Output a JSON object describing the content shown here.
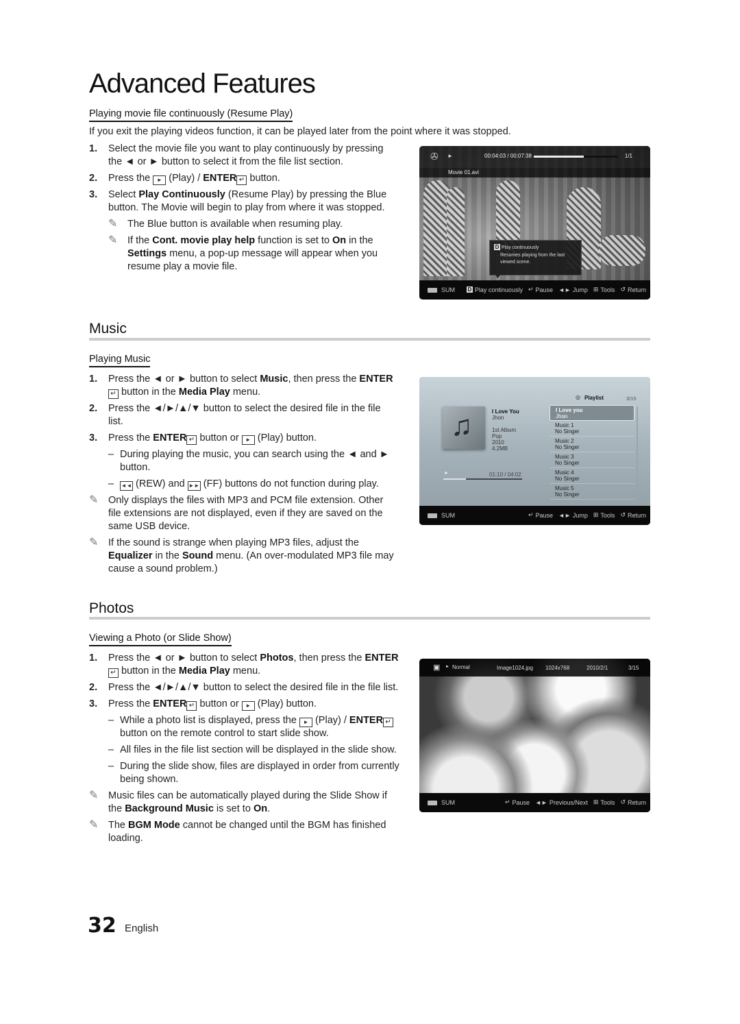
{
  "page": {
    "title": "Advanced Features",
    "page_number": "32",
    "language": "English"
  },
  "resume": {
    "subheading": "Playing movie file continuously (Resume Play)",
    "intro": "If you exit the playing videos function, it can be played later from the point where it was stopped.",
    "steps": [
      {
        "num": "1.",
        "html": "Select the movie file you want to play continuously by pressing the ◄ or ► button to select it from the file list section."
      },
      {
        "num": "2.",
        "html": "Press the <span class='btn-box'>►</span> (Play) / <b>ENTER</b><span class='enter-glyph'>↵</span> button."
      },
      {
        "num": "3.",
        "html": "Select <b>Play Continuously</b> (Resume Play) by pressing the Blue button. The Movie will begin to play from where it was stopped."
      }
    ],
    "notes": [
      {
        "html": "The Blue button is available when resuming play."
      },
      {
        "html": "If the <b>Cont. movie play help</b> function is set to <b>On</b> in the <b>Settings</b> menu, a pop-up message will appear when you resume play a movie file."
      }
    ],
    "screen": {
      "time": "00:04:03 / 00:07:38",
      "progress": 0.59,
      "count": "1/1",
      "filename": "Movie 01.avi",
      "popup_key": "D",
      "popup_title": "Play continuously",
      "popup_text": "Resumes playing from the last viewed scene.",
      "device": "SUM",
      "controls": [
        {
          "key": "D",
          "label": "Play continuously"
        },
        {
          "key": "↵",
          "label": "Pause"
        },
        {
          "key": "◄►",
          "label": "Jump"
        },
        {
          "key": "⊞",
          "label": "Tools"
        },
        {
          "key": "↺",
          "label": "Return"
        }
      ]
    }
  },
  "music": {
    "title": "Music",
    "subheading": "Playing Music",
    "steps": [
      {
        "num": "1.",
        "html": "Press the ◄ or ► button to select <b>Music</b>, then press the <b>ENTER</b><span class='enter-glyph'>↵</span> button in the <b>Media Play</b> menu."
      },
      {
        "num": "2.",
        "html": "Press the ◄/►/▲/▼ button to select the desired file in the file list."
      },
      {
        "num": "3.",
        "html": "Press the <b>ENTER</b><span class='enter-glyph'>↵</span> button or <span class='btn-box'>►</span> (Play) button."
      }
    ],
    "dashes": [
      {
        "html": "During playing the music, you can search using the ◄ and ► button."
      },
      {
        "html": "<span class='btn-box'>◄◄</span> (REW) and <span class='btn-box'>►►</span> (FF) buttons do not function during play."
      }
    ],
    "notes": [
      {
        "html": "Only displays the files with MP3 and PCM file extension. Other file extensions are not displayed, even if they are saved on the same USB device."
      },
      {
        "html": "If the sound is strange when playing MP3 files, adjust the <b>Equalizer</b> in the <b>Sound</b> menu. (An over-modulated MP3 file may cause a sound problem.)"
      }
    ],
    "screen": {
      "playlist_label": "Playlist",
      "count": "3/15",
      "now_title": "I Love You",
      "now_artist": "Jhon",
      "album": "1st Album",
      "genre": "Pop",
      "year": "2010",
      "size": "4.2MB",
      "time": "01:10 / 04:02",
      "progress": 0.29,
      "playlist": [
        {
          "title": "I Love you",
          "artist": "Jhon",
          "selected": true
        },
        {
          "title": "Music 1",
          "artist": "No Singer"
        },
        {
          "title": "Music 2",
          "artist": "No Singer"
        },
        {
          "title": "Music 3",
          "artist": "No Singer"
        },
        {
          "title": "Music 4",
          "artist": "No Singer"
        },
        {
          "title": "Music 5",
          "artist": "No Singer"
        }
      ],
      "device": "SUM",
      "controls": [
        {
          "key": "↵",
          "label": "Pause"
        },
        {
          "key": "◄►",
          "label": "Jump"
        },
        {
          "key": "⊞",
          "label": "Tools"
        },
        {
          "key": "↺",
          "label": "Return"
        }
      ]
    }
  },
  "photos": {
    "title": "Photos",
    "subheading": "Viewing a Photo (or Slide Show)",
    "steps": [
      {
        "num": "1.",
        "html": "Press the ◄ or ► button to select <b>Photos</b>, then press the <b>ENTER</b><span class='enter-glyph'>↵</span> button in the <b>Media Play</b> menu."
      },
      {
        "num": "2.",
        "html": "Press the ◄/►/▲/▼ button to select the desired file in the file list."
      },
      {
        "num": "3.",
        "html": "Press the <b>ENTER</b><span class='enter-glyph'>↵</span> button or <span class='btn-box'>►</span> (Play) button."
      }
    ],
    "dashes": [
      {
        "html": "While a photo list is displayed, press the <span class='btn-box'>►</span> (Play) / <b>ENTER</b><span class='enter-glyph'>↵</span> button on the remote control to start slide show."
      },
      {
        "html": "All files in the file list section will be displayed in the slide show."
      },
      {
        "html": "During the slide show, files are displayed in order from currently being shown."
      }
    ],
    "notes": [
      {
        "html": "Music files can be automatically played during the Slide Show if the <b>Background Music</b> is set to <b>On</b>."
      },
      {
        "html": "The <b>BGM Mode</b> cannot be changed until the BGM has finished loading."
      }
    ],
    "screen": {
      "mode": "Normal",
      "filename": "Image1024.jpg",
      "resolution": "1024x768",
      "date": "2010/2/1",
      "count": "3/15",
      "device": "SUM",
      "controls": [
        {
          "key": "↵",
          "label": "Pause"
        },
        {
          "key": "◄►",
          "label": "Previous/Next"
        },
        {
          "key": "⊞",
          "label": "Tools"
        },
        {
          "key": "↺",
          "label": "Return"
        }
      ]
    }
  },
  "icons": {
    "note": "✎"
  }
}
